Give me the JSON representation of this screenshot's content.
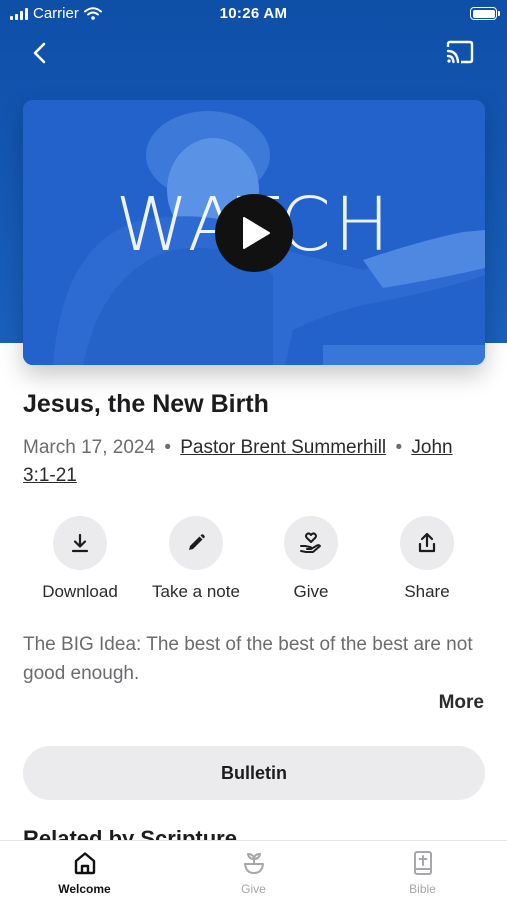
{
  "status_bar": {
    "carrier": "Carrier",
    "time": "10:26 AM"
  },
  "header": {
    "back_icon": "chevron-left-icon",
    "cast_icon": "cast-icon"
  },
  "video": {
    "overlay_text": "WATCH",
    "play_icon": "play-icon"
  },
  "sermon": {
    "title": "Jesus, the New Birth",
    "date": "March 17, 2024",
    "separator": "•",
    "speaker": "Pastor Brent Summerhill",
    "scripture": "John 3:1-21"
  },
  "actions": [
    {
      "label": "Download",
      "icon": "download-icon"
    },
    {
      "label": "Take a note",
      "icon": "pencil-icon"
    },
    {
      "label": "Give",
      "icon": "heart-hand-icon"
    },
    {
      "label": "Share",
      "icon": "share-icon"
    }
  ],
  "description": {
    "text": "The BIG Idea: The best of the best of the best are not good enough.",
    "more_label": "More"
  },
  "bulletin": {
    "label": "Bulletin"
  },
  "related": {
    "heading": "Related by Scripture"
  },
  "tabs": [
    {
      "label": "Welcome",
      "icon": "home-icon",
      "active": true
    },
    {
      "label": "Give",
      "icon": "plant-icon",
      "active": false
    },
    {
      "label": "Bible",
      "icon": "bible-icon",
      "active": false
    }
  ],
  "colors": {
    "accent": "#1559b5",
    "surface": "#ebebed",
    "text": "#1c1c1e",
    "muted": "#6b6b70"
  }
}
